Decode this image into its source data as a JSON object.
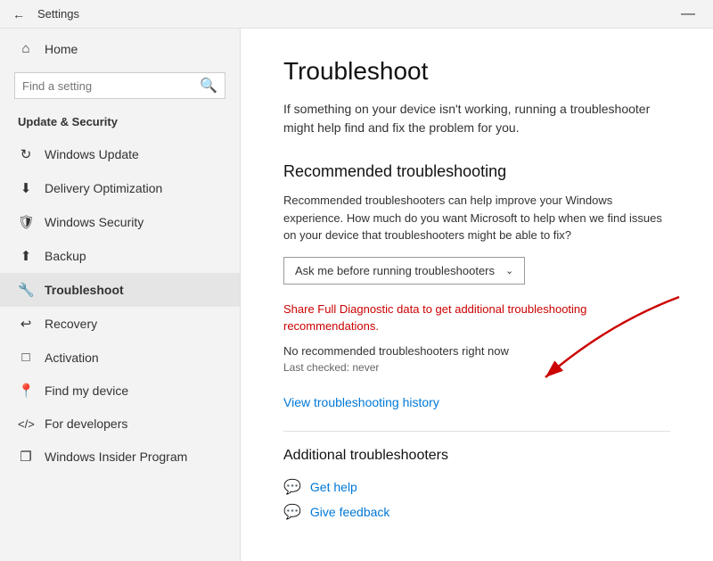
{
  "titlebar": {
    "title": "Settings",
    "min_label": "—"
  },
  "sidebar": {
    "home_label": "Home",
    "search_placeholder": "Find a setting",
    "section_title": "Update & Security",
    "items": [
      {
        "id": "windows-update",
        "label": "Windows Update",
        "icon": "↻"
      },
      {
        "id": "delivery-optimization",
        "label": "Delivery Optimization",
        "icon": "⬇"
      },
      {
        "id": "windows-security",
        "label": "Windows Security",
        "icon": "🛡"
      },
      {
        "id": "backup",
        "label": "Backup",
        "icon": "⬆"
      },
      {
        "id": "troubleshoot",
        "label": "Troubleshoot",
        "icon": "🔧",
        "active": true
      },
      {
        "id": "recovery",
        "label": "Recovery",
        "icon": "↩"
      },
      {
        "id": "activation",
        "label": "Activation",
        "icon": "⊡"
      },
      {
        "id": "find-my-device",
        "label": "Find my device",
        "icon": "📍"
      },
      {
        "id": "for-developers",
        "label": "For developers",
        "icon": "⟨⟩"
      },
      {
        "id": "windows-insider",
        "label": "Windows Insider Program",
        "icon": "🪟"
      }
    ]
  },
  "content": {
    "page_title": "Troubleshoot",
    "page_subtitle": "If something on your device isn't working, running a troubleshooter might help find and fix the problem for you.",
    "recommended_title": "Recommended troubleshooting",
    "recommended_desc": "Recommended troubleshooters can help improve your Windows experience. How much do you want Microsoft to help when we find issues on your device that troubleshooters might be able to fix?",
    "dropdown_label": "Ask me before running troubleshooters",
    "link_red": "Share Full Diagnostic data to get additional troubleshooting recommendations.",
    "no_troubleshooters": "No recommended troubleshooters right now",
    "last_checked": "Last checked: never",
    "view_history_link": "View troubleshooting history",
    "additional_title": "Additional troubleshooters",
    "get_help_label": "Get help",
    "give_feedback_label": "Give feedback"
  }
}
